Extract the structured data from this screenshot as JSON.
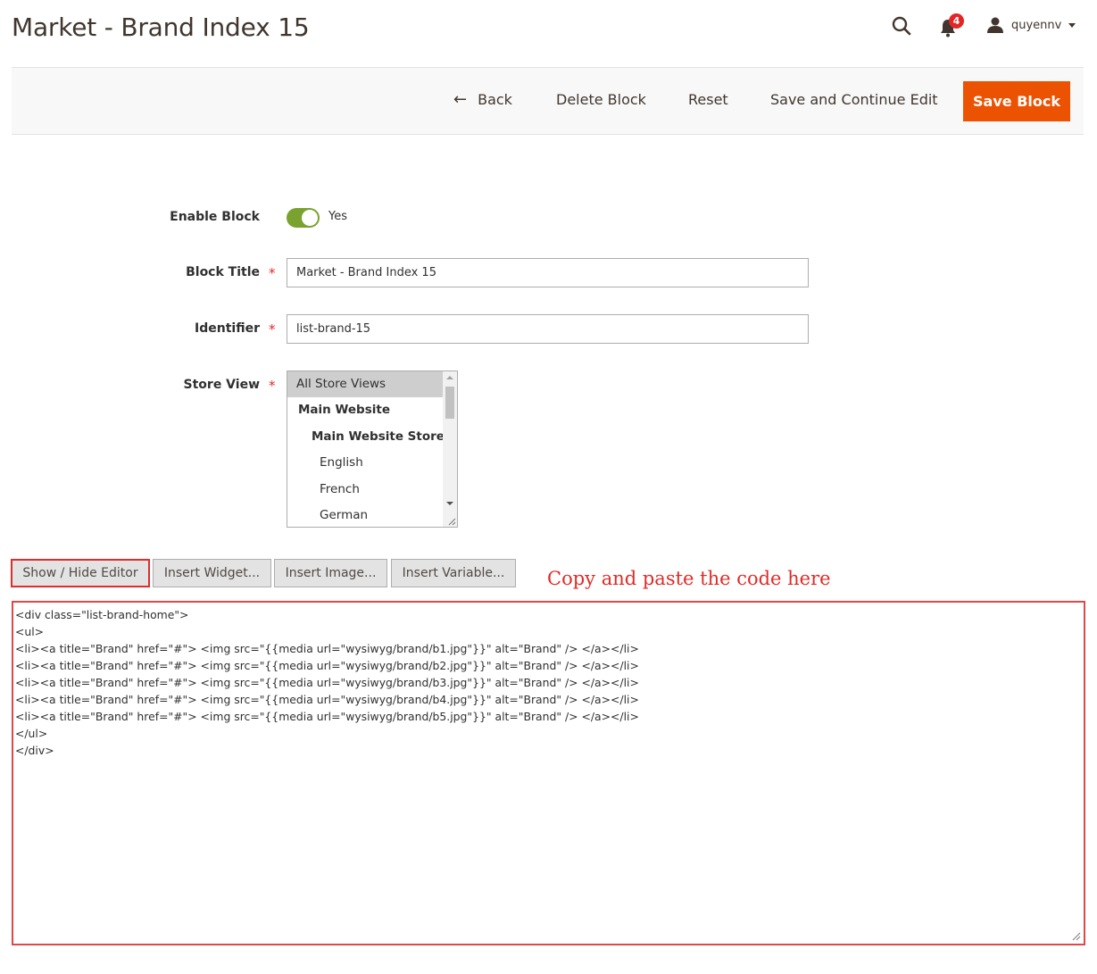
{
  "header": {
    "title": "Market - Brand Index 15",
    "notification_count": "4",
    "username": "quyennv"
  },
  "actions": {
    "back": "Back",
    "delete": "Delete Block",
    "reset": "Reset",
    "save_continue": "Save and Continue Edit",
    "save": "Save Block"
  },
  "form": {
    "enable_label": "Enable Block",
    "enable_value": "Yes",
    "title_label": "Block Title",
    "title_value": "Market - Brand Index 15",
    "identifier_label": "Identifier",
    "identifier_value": "list-brand-15",
    "store_view_label": "Store View",
    "store_views": [
      {
        "label": "All Store Views",
        "selected": true
      },
      {
        "label": "Main Website"
      },
      {
        "label": "Main Website Store"
      },
      {
        "label": "English"
      },
      {
        "label": "French"
      },
      {
        "label": "German"
      }
    ]
  },
  "editor": {
    "show_hide": "Show / Hide Editor",
    "insert_widget": "Insert Widget...",
    "insert_image": "Insert Image...",
    "insert_variable": "Insert Variable...",
    "hint": "Copy and paste the code here",
    "code_lines": [
      "<div class=\"list-brand-home\">",
      "<ul>",
      "<li><a title=\"Brand\" href=\"#\"> <img src=\"{{media url=\"wysiwyg/brand/b1.jpg\"}}\" alt=\"Brand\" /> </a></li>",
      "<li><a title=\"Brand\" href=\"#\"> <img src=\"{{media url=\"wysiwyg/brand/b2.jpg\"}}\" alt=\"Brand\" /> </a></li>",
      "<li><a title=\"Brand\" href=\"#\"> <img src=\"{{media url=\"wysiwyg/brand/b3.jpg\"}}\" alt=\"Brand\" /> </a></li>",
      "<li><a title=\"Brand\" href=\"#\"> <img src=\"{{media url=\"wysiwyg/brand/b4.jpg\"}}\" alt=\"Brand\" /> </a></li>",
      "<li><a title=\"Brand\" href=\"#\"> <img src=\"{{media url=\"wysiwyg/brand/b5.jpg\"}}\" alt=\"Brand\" /> </a></li>",
      "</ul>",
      "</div>"
    ]
  },
  "colors": {
    "primary": "#eb5202",
    "toggle_on": "#79a22e",
    "highlight": "#e22c2c",
    "required": "#e02b27"
  }
}
